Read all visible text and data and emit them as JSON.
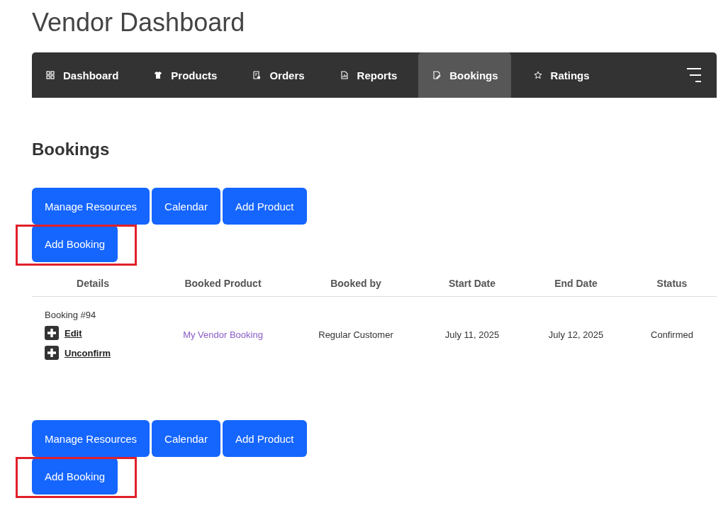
{
  "page_title": "Vendor Dashboard",
  "nav": {
    "items": [
      {
        "label": "Dashboard",
        "kind": "grid",
        "selected": false
      },
      {
        "label": "Products",
        "kind": "shirt",
        "selected": false
      },
      {
        "label": "Orders",
        "kind": "receipt",
        "selected": false
      },
      {
        "label": "Reports",
        "kind": "chart",
        "selected": false
      },
      {
        "label": "Bookings",
        "kind": "edit",
        "selected": true
      },
      {
        "label": "Ratings",
        "kind": "star",
        "selected": false
      }
    ]
  },
  "section_title": "Bookings",
  "top_actions": [
    {
      "label": "Manage Resources",
      "highlighted": false
    },
    {
      "label": "Calendar",
      "highlighted": false
    },
    {
      "label": "Add Product",
      "highlighted": false
    },
    {
      "label": "Add Booking",
      "highlighted": true
    }
  ],
  "table": {
    "columns": [
      "Details",
      "Booked Product",
      "Booked by",
      "Start Date",
      "End Date",
      "Status"
    ],
    "rows": [
      {
        "title": "Booking #94",
        "actions": [
          "Edit",
          "Unconfirm"
        ],
        "booked_product": "My Vendor Booking",
        "booked_by": "Regular Customer",
        "start_date": "July 11, 2025",
        "end_date": "July 12, 2025",
        "status": "Confirmed"
      }
    ]
  },
  "bottom_actions": [
    {
      "label": "Manage Resources",
      "highlighted": false
    },
    {
      "label": "Calendar",
      "highlighted": false
    },
    {
      "label": "Add Product",
      "highlighted": false
    },
    {
      "label": "Add Booking",
      "highlighted": true
    }
  ]
}
